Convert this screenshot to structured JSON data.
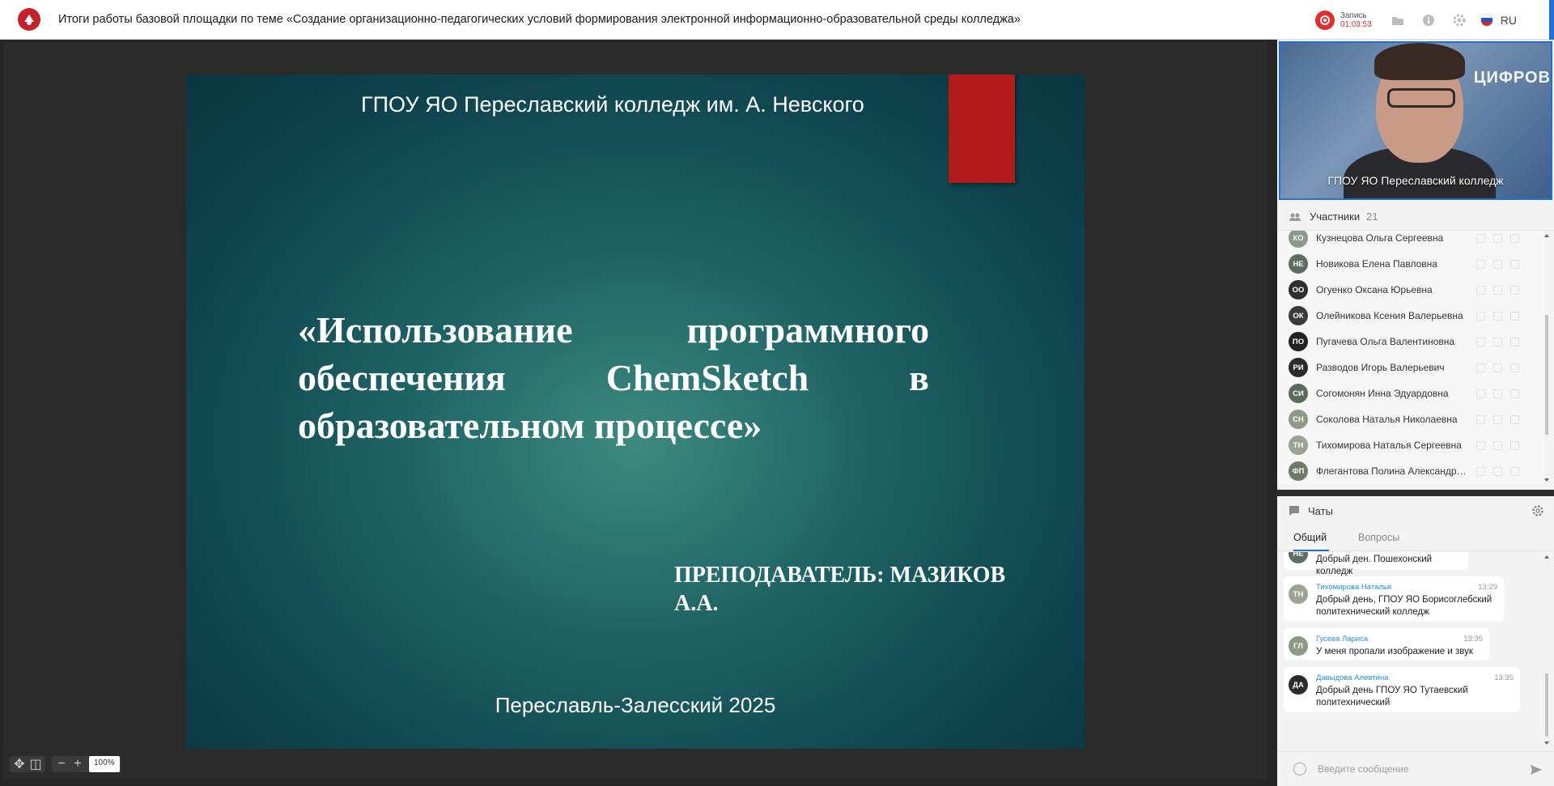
{
  "header": {
    "title": "Итоги работы базовой площадки по теме «Создание организационно-педагогических условий формирования электронной информационно-образовательной среды колледжа»",
    "recording_label": "Запись",
    "recording_time": "01:03:53",
    "language": "RU"
  },
  "slide": {
    "org": "ГПОУ ЯО Переславский колледж им. А. Невского",
    "topic": "«Использование программного обеспечения ChemSketch в образовательном процессе»",
    "teacher": "ПРЕПОДАВАТЕЛЬ: МАЗИКОВ А.А.",
    "footer": "Переславль-Залесский 2025"
  },
  "zoom": {
    "value": "100%"
  },
  "video": {
    "label": "ГПОУ ЯО Переславский колледж",
    "banner": "ЦИФРОВ"
  },
  "participants": {
    "title": "Участники",
    "count": "21",
    "items": [
      {
        "initials": "КО",
        "name": "Кузнецова Ольга Сергеевна",
        "color": "#8a9a8a"
      },
      {
        "initials": "НЕ",
        "name": "Новикова Елена Павловна",
        "color": "#5d6d5f"
      },
      {
        "initials": "ОО",
        "name": "Огуенко Оксана Юрьевна",
        "color": "#2f2f2f"
      },
      {
        "initials": "ОК",
        "name": "Олейникова Ксения Валерьевна",
        "color": "#3b3b3b"
      },
      {
        "initials": "ПО",
        "name": "Пугачева Ольга Валентиновна",
        "color": "#222222"
      },
      {
        "initials": "РИ",
        "name": "Разводов Игорь Валерьевич",
        "color": "#2b2b2b"
      },
      {
        "initials": "СИ",
        "name": "Согомонян Инна Эдуардовна",
        "color": "#5b6b5b"
      },
      {
        "initials": "СН",
        "name": "Соколова Наталья Николаевна",
        "color": "#8f9a86"
      },
      {
        "initials": "ТН",
        "name": "Тихомирова Наталья Сергеевна",
        "color": "#9aa394"
      },
      {
        "initials": "ФП",
        "name": "Флегантова Полина Александро...",
        "color": "#6f7a68"
      }
    ]
  },
  "chats": {
    "title": "Чаты",
    "tabs": {
      "general": "Общий",
      "questions": "Вопросы"
    },
    "messages": [
      {
        "initials": "НЕ",
        "color": "#5d6d5f",
        "author": "",
        "time": "",
        "text": "Добрый ден. Пошехонский колледж"
      },
      {
        "initials": "ТН",
        "color": "#9aa394",
        "author": "Тихомирова Наталья",
        "time": "13:29",
        "text": "Добрый день, ГПОУ ЯО Борисоглебский политехнический колледж"
      },
      {
        "initials": "ГЛ",
        "color": "#8f9a86",
        "author": "Гусева Лариса",
        "time": "13:35",
        "text": "У меня пропали изображение и звук"
      },
      {
        "initials": "ДА",
        "color": "#2b2b2b",
        "author": "Давыдова Алевтина",
        "time": "13:35",
        "text": "Добрый день ГПОУ ЯО Тутаевский политехнический"
      }
    ],
    "input_placeholder": "Введите сообщение"
  }
}
